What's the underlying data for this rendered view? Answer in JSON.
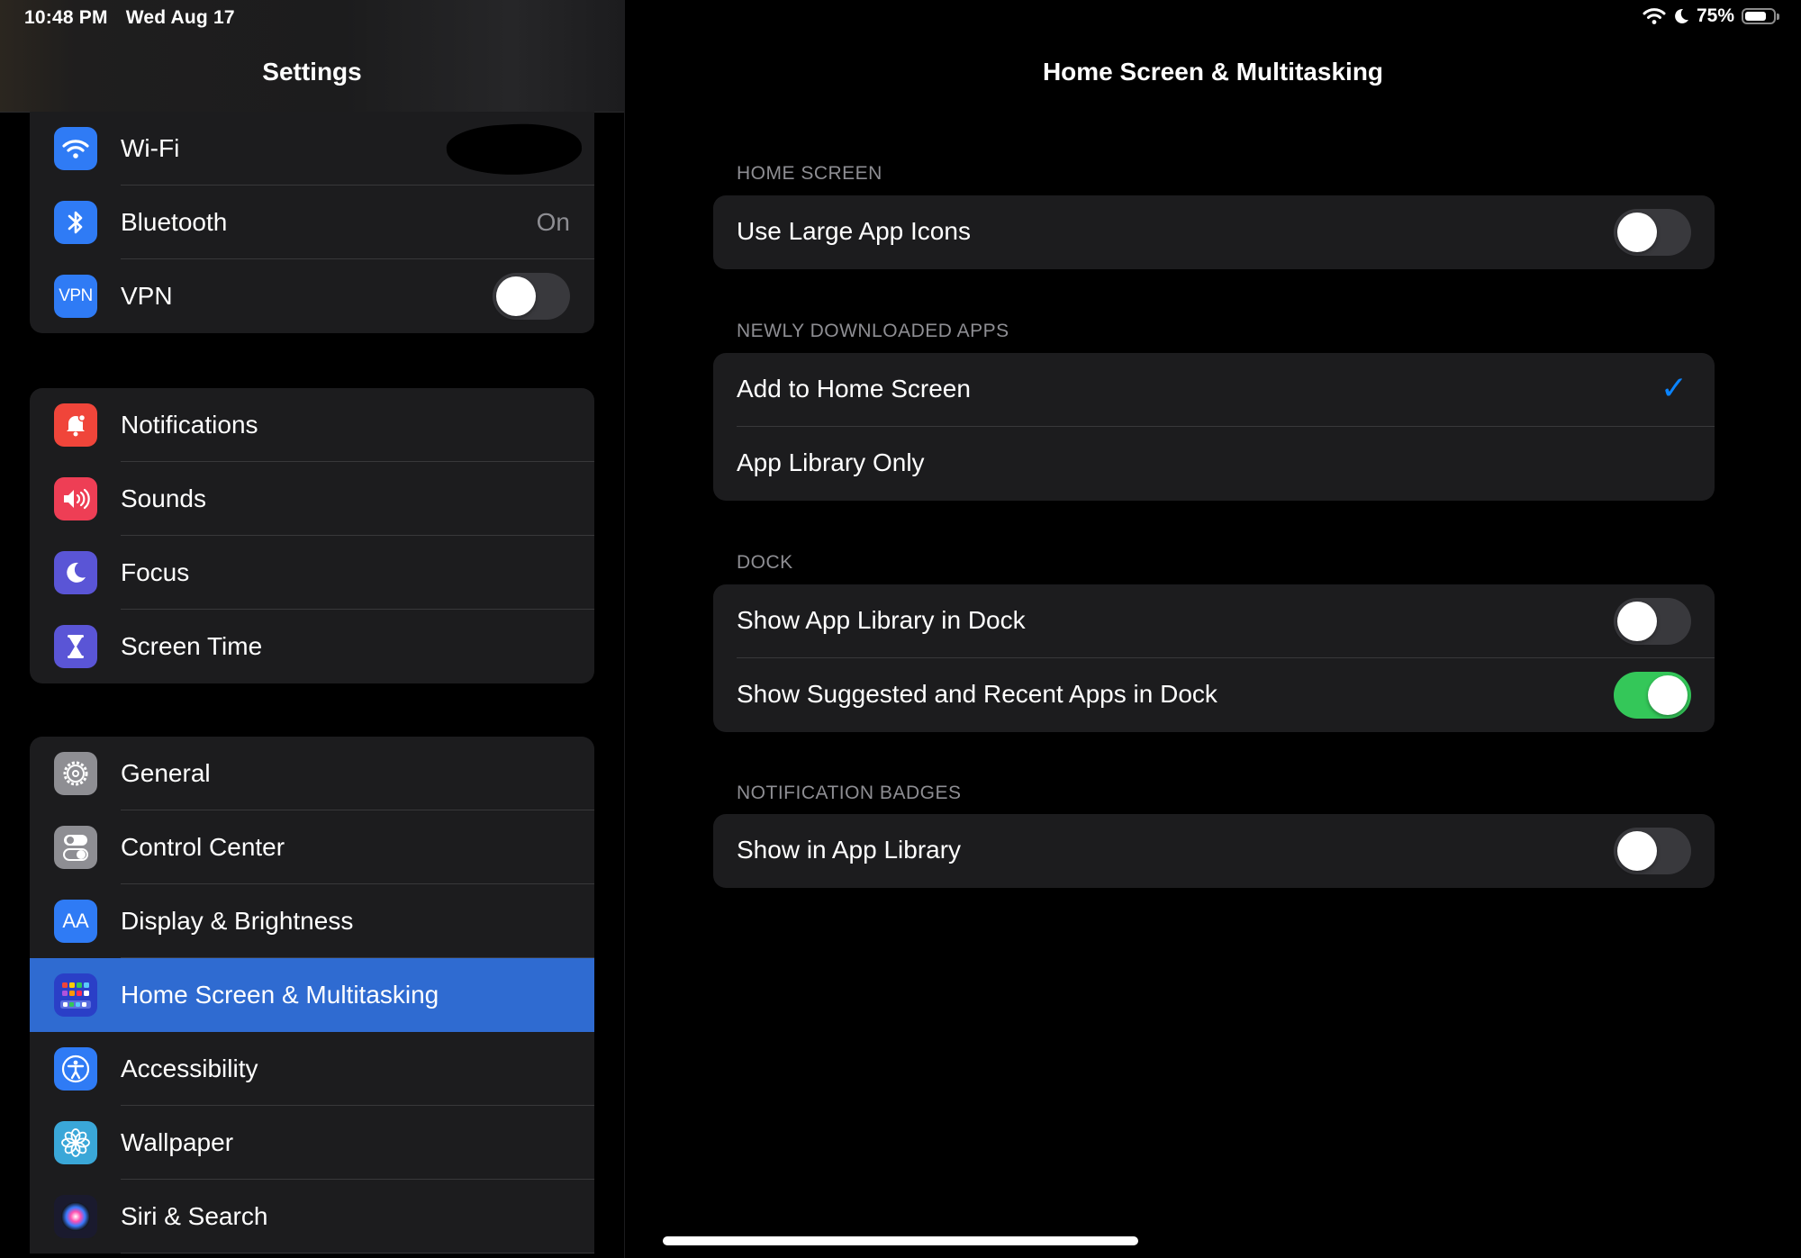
{
  "status_bar": {
    "time": "10:48 PM",
    "date": "Wed Aug 17",
    "battery_percent": "75%",
    "battery_level": 0.75,
    "icons": [
      "wifi-icon",
      "moon-icon",
      "battery-icon"
    ]
  },
  "sidebar": {
    "title": "Settings",
    "groups": [
      {
        "items": [
          {
            "label": "Wi-Fi",
            "icon": "wifi-icon",
            "icon_color": "#2f7bf5",
            "value_redacted": true
          },
          {
            "label": "Bluetooth",
            "icon": "bluetooth-icon",
            "icon_color": "#2f7bf5",
            "value": "On"
          },
          {
            "label": "VPN",
            "icon": "vpn-icon",
            "icon_color": "#2f7bf5",
            "icon_text": "VPN",
            "toggle_on": false
          }
        ]
      },
      {
        "items": [
          {
            "label": "Notifications",
            "icon": "bell-icon",
            "icon_color": "#f0453a"
          },
          {
            "label": "Sounds",
            "icon": "speaker-icon",
            "icon_color": "#ee3e55"
          },
          {
            "label": "Focus",
            "icon": "moon-icon",
            "icon_color": "#5a55d6"
          },
          {
            "label": "Screen Time",
            "icon": "hourglass-icon",
            "icon_color": "#5a55d6"
          }
        ]
      },
      {
        "items": [
          {
            "label": "General",
            "icon": "gear-icon",
            "icon_color": "#8e8e93"
          },
          {
            "label": "Control Center",
            "icon": "switches-icon",
            "icon_color": "#8e8e93"
          },
          {
            "label": "Display & Brightness",
            "icon": "text-size-icon",
            "icon_color": "#2f7bf5",
            "icon_text": "AA"
          },
          {
            "label": "Home Screen & Multitasking",
            "icon": "app-grid-icon",
            "icon_color": "#2a3fc7",
            "selected": true
          },
          {
            "label": "Accessibility",
            "icon": "accessibility-icon",
            "icon_color": "#2f7bf5"
          },
          {
            "label": "Wallpaper",
            "icon": "flower-icon",
            "icon_color": "#3aa7d8"
          },
          {
            "label": "Siri & Search",
            "icon": "siri-icon",
            "icon_color": "#222"
          }
        ]
      }
    ]
  },
  "detail": {
    "title": "Home Screen & Multitasking",
    "sections": {
      "home_screen": {
        "header": "HOME SCREEN",
        "large_icons_label": "Use Large App Icons",
        "large_icons_on": false
      },
      "newly_downloaded": {
        "header": "NEWLY DOWNLOADED APPS",
        "add_home_label": "Add to Home Screen",
        "add_home_checked": true,
        "app_library_only_label": "App Library Only",
        "checkmark": "✓"
      },
      "dock": {
        "header": "DOCK",
        "show_library_label": "Show App Library in Dock",
        "show_library_on": false,
        "suggested_label": "Show Suggested and Recent Apps in Dock",
        "suggested_on": true
      },
      "badges": {
        "header": "NOTIFICATION BADGES",
        "show_in_library_label": "Show in App Library",
        "show_in_library_on": false
      }
    }
  },
  "colors": {
    "accent": "#0a84ff",
    "selection": "#2f6bd1",
    "toggle_on": "#34c759",
    "toggle_off": "#39393d",
    "cell_background": "#1c1c1e"
  }
}
